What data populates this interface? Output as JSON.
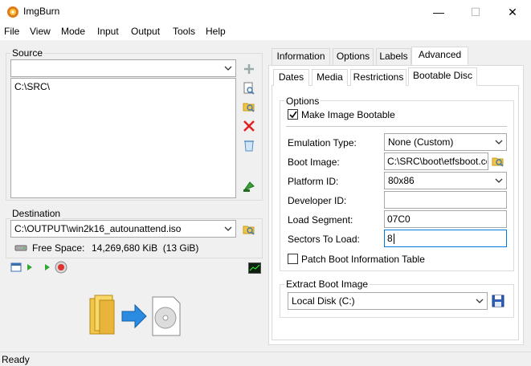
{
  "window": {
    "title": "ImgBurn",
    "minimize_glyph": "—",
    "maximize_glyph": "☐",
    "close_glyph": "✕"
  },
  "menu": [
    "File",
    "View",
    "Mode",
    "Input",
    "Output",
    "Tools",
    "Help"
  ],
  "source": {
    "label": "Source",
    "combo_value": "",
    "files": [
      "C:\\SRC\\"
    ],
    "buttons": [
      "add-file-icon",
      "browse-folder-icon",
      "search-folder-icon",
      "remove-icon",
      "clear-list-icon",
      "calculate-icon"
    ]
  },
  "destination": {
    "label": "Destination",
    "path": "C:\\OUTPUT\\win2k16_autounattend.iso",
    "free_space_label": "Free Space:",
    "free_space_value": "14,269,680 KiB  (13 GiB)"
  },
  "tabs_top": [
    "Information",
    "Options",
    "Labels",
    "Advanced"
  ],
  "tabs_top_active": "Advanced",
  "tabs_sub": [
    "Dates",
    "Media",
    "Restrictions",
    "Bootable Disc"
  ],
  "tabs_sub_active": "Bootable Disc",
  "options": {
    "label": "Options",
    "make_bootable_label": "Make Image Bootable",
    "make_bootable_checked": true,
    "emulation_type_label": "Emulation Type:",
    "emulation_type_value": "None (Custom)",
    "boot_image_label": "Boot Image:",
    "boot_image_value": "C:\\SRC\\boot\\etfsboot.com",
    "platform_id_label": "Platform ID:",
    "platform_id_value": "80x86",
    "developer_id_label": "Developer ID:",
    "developer_id_value": "",
    "load_segment_label": "Load Segment:",
    "load_segment_value": "07C0",
    "sectors_to_load_label": "Sectors To Load:",
    "sectors_to_load_value": "8",
    "patch_label": "Patch Boot Information Table",
    "patch_checked": false
  },
  "extract": {
    "label": "Extract Boot Image",
    "drive_value": "Local Disk (C:)"
  },
  "status": "Ready",
  "colors": {
    "accent": "#0078d7",
    "window_bg": "#f0f0f0",
    "border": "#a8a8a8"
  }
}
